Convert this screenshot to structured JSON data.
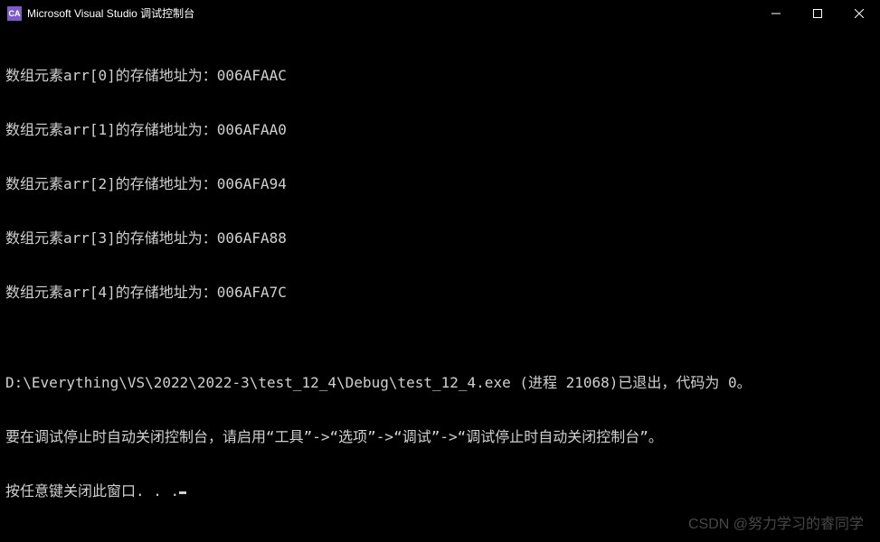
{
  "window": {
    "icon_label": "CA",
    "title": "Microsoft Visual Studio 调试控制台"
  },
  "console": {
    "lines": [
      "数组元素arr[0]的存储地址为：006AFAAC",
      "数组元素arr[1]的存储地址为：006AFAA0",
      "数组元素arr[2]的存储地址为：006AFA94",
      "数组元素arr[3]的存储地址为：006AFA88",
      "数组元素arr[4]的存储地址为：006AFA7C",
      "",
      "D:\\Everything\\VS\\2022\\2022-3\\test_12_4\\Debug\\test_12_4.exe (进程 21068)已退出，代码为 0。",
      "要在调试停止时自动关闭控制台，请启用“工具”->“选项”->“调试”->“调试停止时自动关闭控制台”。",
      "按任意键关闭此窗口. . ."
    ]
  },
  "watermark": "CSDN @努力学习的睿同学"
}
